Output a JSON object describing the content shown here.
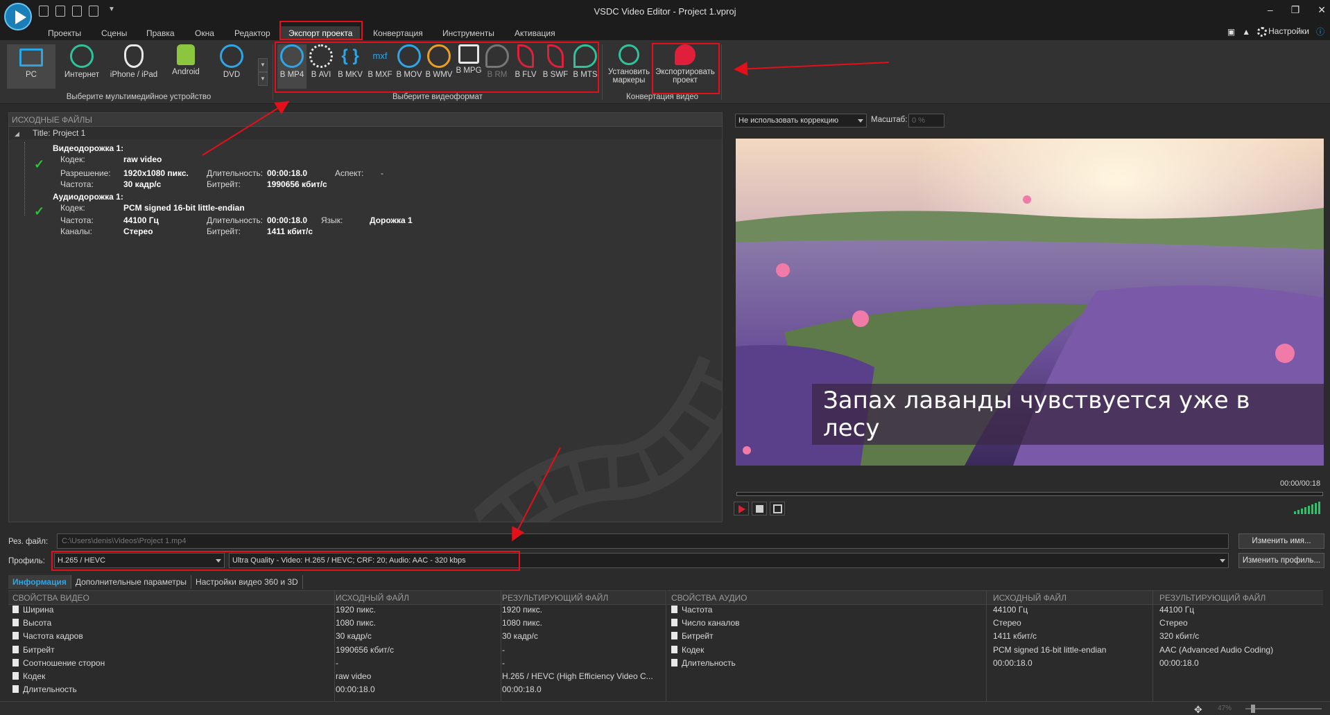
{
  "window": {
    "title": "VSDC Video Editor - Project 1.vproj"
  },
  "menu": {
    "items": [
      "Проекты",
      "Сцены",
      "Правка",
      "Окна",
      "Редактор",
      "Экспорт проекта",
      "Конвертация",
      "Инструменты",
      "Активация"
    ],
    "active_index": 5,
    "settings_label": "Настройки"
  },
  "ribbon": {
    "devices": [
      {
        "label": "PC",
        "icon": "monitor-icon"
      },
      {
        "label": "Интернет",
        "icon": "globe-icon"
      },
      {
        "label": "iPhone / iPad",
        "icon": "apple-icon"
      },
      {
        "label": "Android",
        "icon": "android-icon"
      },
      {
        "label": "DVD",
        "icon": "dvd-icon"
      }
    ],
    "devices_caption": "Выберите мультимедийное устройство",
    "formats": [
      {
        "label": "В MP4",
        "icon": "mp4-icon"
      },
      {
        "label": "В AVI",
        "icon": "film-reel-icon"
      },
      {
        "label": "В MKV",
        "icon": "mkv-icon"
      },
      {
        "label": "В MXF",
        "icon": "mxf-icon"
      },
      {
        "label": "В MOV",
        "icon": "mov-icon"
      },
      {
        "label": "В WMV",
        "icon": "wmv-icon"
      },
      {
        "label": "В MPG",
        "icon": "mpg-icon"
      },
      {
        "label": "В RM",
        "icon": "rm-icon"
      },
      {
        "label": "В FLV",
        "icon": "flv-icon"
      },
      {
        "label": "В SWF",
        "icon": "swf-icon"
      },
      {
        "label": "В MTS",
        "icon": "mts-icon"
      }
    ],
    "formats_caption": "Выберите видеоформат",
    "set_markers": "Установить маркеры",
    "export_project": "Экспортировать проект",
    "convert_caption": "Конвертация видео"
  },
  "source": {
    "header": "ИСХОДНЫЕ ФАЙЛЫ",
    "project_title": "Title: Project 1",
    "video": {
      "heading": "Видеодорожка 1:",
      "codec_label": "Кодек:",
      "codec": "raw video",
      "resolution_label": "Разрешение:",
      "resolution": "1920x1080 пикс.",
      "duration_label": "Длительность:",
      "duration": "00:00:18.0",
      "aspect_label": "Аспект:",
      "aspect": "-",
      "fps_label": "Частота:",
      "fps": "30 кадр/с",
      "bitrate_label": "Битрейт:",
      "bitrate": "1990656 кбит/с"
    },
    "audio": {
      "heading": "Аудиодорожка 1:",
      "codec_label": "Кодек:",
      "codec": "PCM signed 16-bit little-endian",
      "freq_label": "Частота:",
      "freq": "44100 Гц",
      "duration_label": "Длительность:",
      "duration": "00:00:18.0",
      "lang_label": "Язык:",
      "lang": "Дорожка 1",
      "channels_label": "Каналы:",
      "channels": "Стерео",
      "bitrate_label": "Битрейт:",
      "bitrate": "1411 кбит/с"
    }
  },
  "preview": {
    "correction": "Не использовать коррекцию",
    "scale_label": "Масштаб:",
    "scale_value": "0 %",
    "caption": "Запах лаванды чувствуется уже в лесу",
    "timecode": "00:00/00:18"
  },
  "output": {
    "file_label": "Рез. файл:",
    "file_path": "C:\\Users\\denis\\Videos\\Project 1.mp4",
    "rename_button": "Изменить имя...",
    "profile_label": "Профиль:",
    "codec_profile": "H.265 / HEVC",
    "quality_profile": "Ultra Quality - Video: H.265 / HEVC; CRF: 20; Audio: AAC - 320 kbps",
    "change_profile_button": "Изменить профиль..."
  },
  "tabs": [
    "Информация",
    "Дополнительные параметры",
    "Настройки видео 360 и 3D"
  ],
  "video_props": {
    "headers": [
      "СВОЙСТВА ВИДЕО",
      "ИСХОДНЫЙ ФАЙЛ",
      "РЕЗУЛЬТИРУЮЩИЙ ФАЙЛ"
    ],
    "rows": [
      [
        "Ширина",
        "1920 пикс.",
        "1920 пикс."
      ],
      [
        "Высота",
        "1080 пикс.",
        "1080 пикс."
      ],
      [
        "Частота кадров",
        "30 кадр/с",
        "30 кадр/с"
      ],
      [
        "Битрейт",
        "1990656 кбит/с",
        "-"
      ],
      [
        "Соотношение сторон",
        "-",
        "-"
      ],
      [
        "Кодек",
        "raw video",
        "H.265 / HEVC (High Efficiency Video C..."
      ],
      [
        "Длительность",
        "00:00:18.0",
        "00:00:18.0"
      ]
    ]
  },
  "audio_props": {
    "headers": [
      "СВОЙСТВА АУДИО",
      "ИСХОДНЫЙ ФАЙЛ",
      "РЕЗУЛЬТИРУЮЩИЙ ФАЙЛ"
    ],
    "rows": [
      [
        "Частота",
        "44100 Гц",
        "44100 Гц"
      ],
      [
        "Число каналов",
        "Стерео",
        "Стерео"
      ],
      [
        "Битрейт",
        "1411 кбит/с",
        "320 кбит/с"
      ],
      [
        "Кодек",
        "PCM signed 16-bit little-endian",
        "AAC (Advanced Audio Coding)"
      ],
      [
        "Длительность",
        "00:00:18.0",
        "00:00:18.0"
      ]
    ]
  },
  "status": {
    "zoom": "47%"
  },
  "colors": {
    "accent": "#2ea6e6",
    "highlight": "#e3101a",
    "ok": "#2ec33a"
  }
}
